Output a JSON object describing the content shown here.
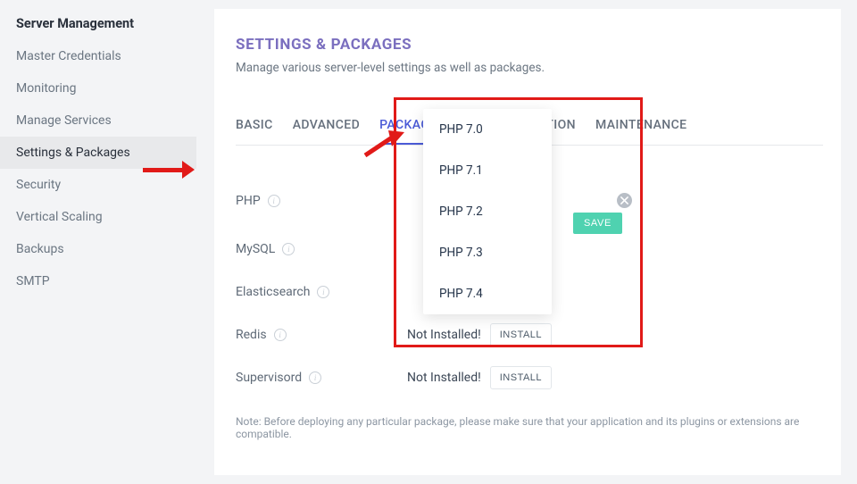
{
  "sidebar": {
    "title": "Server Management",
    "items": [
      {
        "label": "Master Credentials"
      },
      {
        "label": "Monitoring"
      },
      {
        "label": "Manage Services"
      },
      {
        "label": "Settings & Packages",
        "active": true
      },
      {
        "label": "Security"
      },
      {
        "label": "Vertical Scaling"
      },
      {
        "label": "Backups"
      },
      {
        "label": "SMTP"
      }
    ]
  },
  "main": {
    "title": "SETTINGS & PACKAGES",
    "subtitle": "Manage various server-level settings as well as packages.",
    "tabs": [
      {
        "label": "BASIC"
      },
      {
        "label": "ADVANCED"
      },
      {
        "label": "PACKAGES",
        "active": true
      },
      {
        "label": "OPTIMIZATION",
        "label_partial": "ATION"
      },
      {
        "label": "MAINTENANCE"
      }
    ],
    "save_label": "SAVE",
    "packages": [
      {
        "name": "PHP"
      },
      {
        "name": "MySQL"
      },
      {
        "name": "Elasticsearch"
      },
      {
        "name": "Redis",
        "status": "Not Installed!",
        "action": "INSTALL"
      },
      {
        "name": "Supervisord",
        "status": "Not Installed!",
        "action": "INSTALL"
      }
    ],
    "note": "Note: Before deploying any particular package, please make sure that your application and its plugins or extensions are compatible."
  },
  "dropdown": {
    "options": [
      "PHP 7.0",
      "PHP 7.1",
      "PHP 7.2",
      "PHP 7.3",
      "PHP 7.4"
    ]
  },
  "colors": {
    "accent": "#4b5bd7",
    "title": "#7b6fbf",
    "save": "#4fd2b0",
    "annotation": "#e11a18"
  }
}
